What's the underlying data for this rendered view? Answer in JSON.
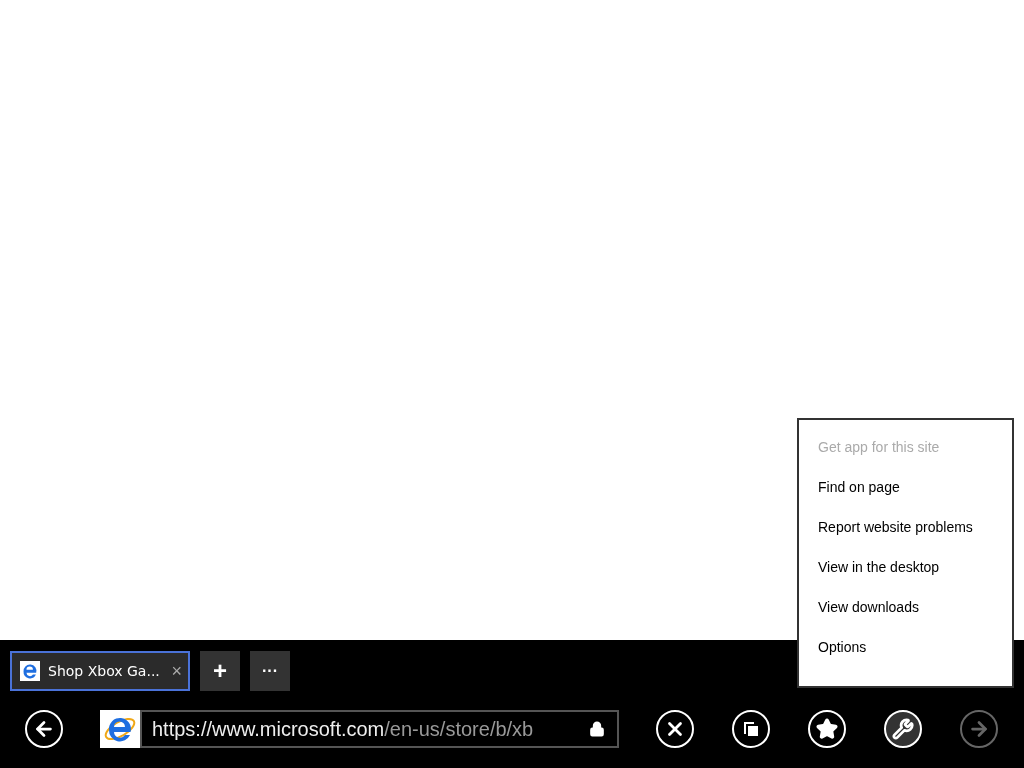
{
  "tabs": [
    {
      "title": "Shop Xbox Ga...",
      "close": "×",
      "selected": true
    }
  ],
  "tab_actions": [
    {
      "kind": "new",
      "label": "+"
    },
    {
      "kind": "more",
      "label": "···"
    }
  ],
  "address_bar": {
    "host": "https://www.microsoft.com",
    "path": "/en-us/store/b/xb",
    "secure": true
  },
  "nav_buttons": [
    {
      "kind": "back",
      "disabled": false,
      "pressed": false
    }
  ],
  "toolbar_buttons": [
    {
      "kind": "stop",
      "disabled": false,
      "pressed": false
    },
    {
      "kind": "tabs",
      "disabled": false,
      "pressed": false
    },
    {
      "kind": "favorites",
      "disabled": false,
      "pressed": false
    },
    {
      "kind": "tools",
      "disabled": false,
      "pressed": true
    },
    {
      "kind": "forward",
      "disabled": true,
      "pressed": false
    }
  ],
  "tools_menu": [
    {
      "label": "Get app for this site",
      "disabled": true
    },
    {
      "label": "Find on page",
      "disabled": false
    },
    {
      "label": "Report website problems",
      "disabled": false
    },
    {
      "label": "View in the desktop",
      "disabled": false
    },
    {
      "label": "View downloads",
      "disabled": false
    },
    {
      "label": "Options",
      "disabled": false
    }
  ]
}
